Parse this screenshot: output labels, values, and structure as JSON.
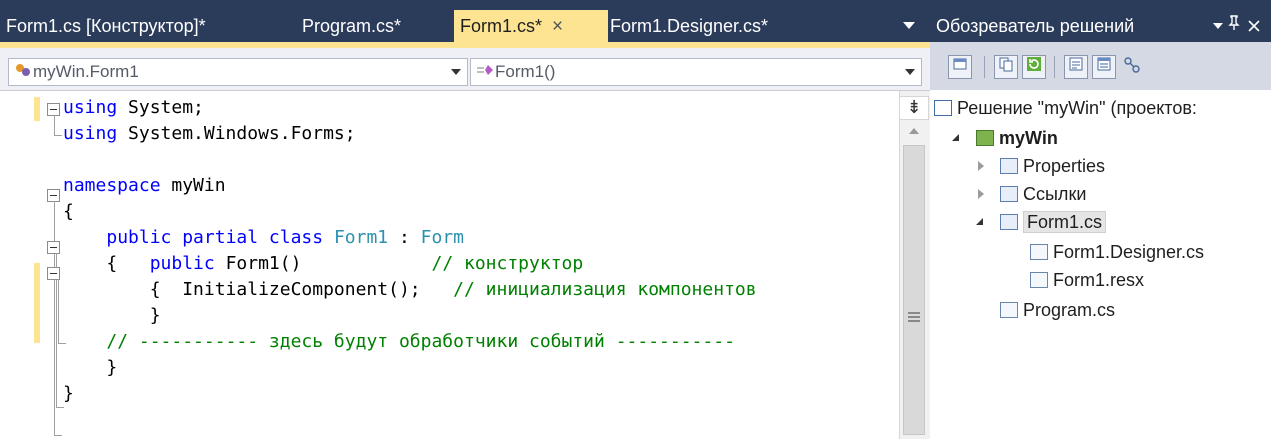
{
  "editor": {
    "tabs": [
      {
        "label": "Form1.cs [Конструктор]*",
        "active": false
      },
      {
        "label": "Program.cs*",
        "active": false
      },
      {
        "label": "Form1.cs*",
        "active": true,
        "close": "×"
      },
      {
        "label": "Form1.Designer.cs*",
        "active": false
      }
    ],
    "nav": {
      "type_combo": "myWin.Form1",
      "member_combo": "Form1()"
    },
    "code_lines": [
      [
        [
          "kw",
          "using"
        ],
        [
          "",
          " System;"
        ]
      ],
      [
        [
          "kw",
          "using"
        ],
        [
          "",
          " System.Windows.Forms;"
        ]
      ],
      [],
      [
        [
          "kw",
          "namespace"
        ],
        [
          "",
          " myWin"
        ]
      ],
      [
        [
          "",
          "{"
        ]
      ],
      [
        [
          "",
          "    "
        ],
        [
          "kw",
          "public partial class"
        ],
        [
          "",
          " "
        ],
        [
          "type",
          "Form1"
        ],
        [
          "",
          " : "
        ],
        [
          "type",
          "Form"
        ]
      ],
      [
        [
          "",
          "    {   "
        ],
        [
          "kw",
          "public"
        ],
        [
          "",
          " Form1()            "
        ],
        [
          "cm",
          "// конструктор"
        ]
      ],
      [
        [
          "",
          "        {  InitializeComponent();   "
        ],
        [
          "cm",
          "// инициализация компонентов"
        ]
      ],
      [
        [
          "",
          "        }"
        ]
      ],
      [
        [
          "",
          "    "
        ],
        [
          "cm",
          "// ----------- здесь будут обработчики событий -----------"
        ]
      ],
      [
        [
          "",
          "    }"
        ]
      ],
      [
        [
          "",
          "}"
        ]
      ]
    ],
    "colors": {
      "keyword": "#0000ff",
      "type": "#2b91af",
      "comment": "#008000",
      "active_tab": "#fde493",
      "chrome": "#2b3b5a"
    }
  },
  "explorer": {
    "title": "Обозреватель решений",
    "pin_icon": "pin-icon",
    "close_icon": "close-icon",
    "tree": [
      {
        "label": "Решение \"myWin\"  (проектов:",
        "icon": "solution-icon",
        "level": 0,
        "toggle": "none"
      },
      {
        "label": "myWin",
        "icon": "csharp-project-icon",
        "level": 1,
        "toggle": "expanded",
        "bold": true
      },
      {
        "label": "Properties",
        "icon": "properties-icon",
        "level": 2,
        "toggle": "collapsed"
      },
      {
        "label": "Ссылки",
        "icon": "references-icon",
        "level": 2,
        "toggle": "collapsed"
      },
      {
        "label": "Form1.cs",
        "icon": "form-icon",
        "level": 2,
        "toggle": "expanded",
        "selected": true
      },
      {
        "label": "Form1.Designer.cs",
        "icon": "cs-file-icon",
        "level": 3,
        "toggle": "none"
      },
      {
        "label": "Form1.resx",
        "icon": "resx-file-icon",
        "level": 3,
        "toggle": "none"
      },
      {
        "label": "Program.cs",
        "icon": "cs-file-icon",
        "level": 2,
        "toggle": "none"
      }
    ]
  }
}
